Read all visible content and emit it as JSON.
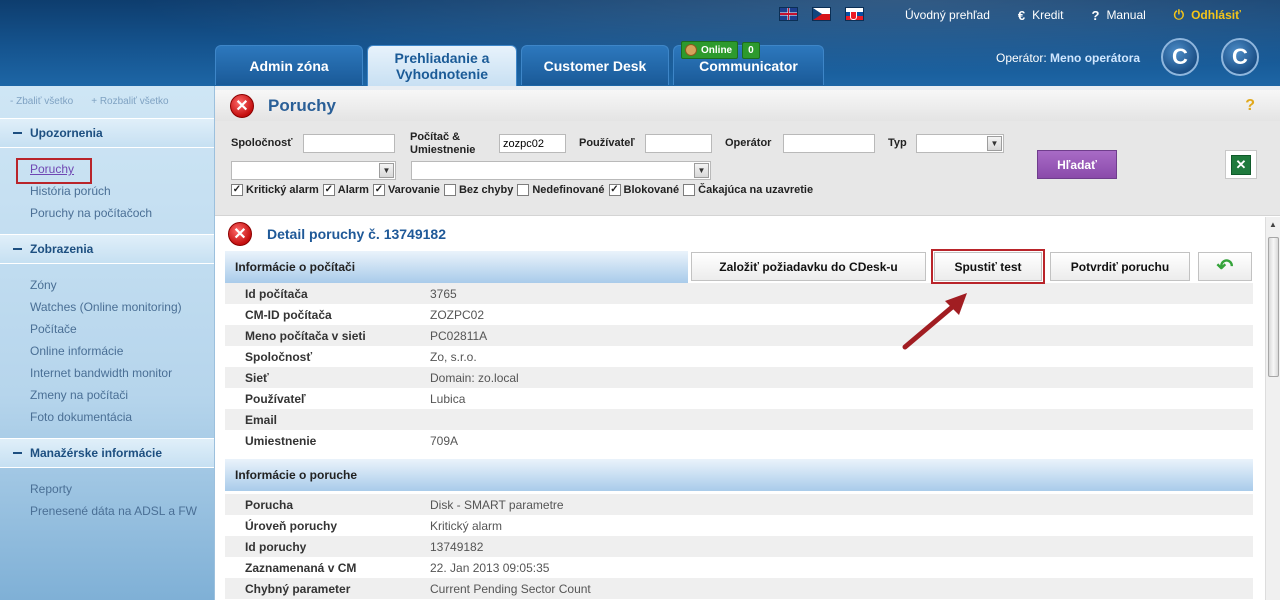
{
  "header": {
    "flags": [
      "uk-flag",
      "cz-flag",
      "sk-flag"
    ],
    "links": {
      "home": "Úvodný prehľad",
      "credit": "Kredit",
      "manual": "Manual",
      "logout": "Odhlásiť"
    },
    "tabs": [
      "Admin zóna",
      "Prehliadanie a Vyhodnotenie",
      "Customer Desk",
      "Communicator"
    ],
    "online": {
      "label": "Online",
      "count": "0"
    },
    "operator": {
      "label": "Operátor:",
      "name": "Meno operátora"
    }
  },
  "sidebar": {
    "collapse_all": "- Zbaliť všetko",
    "expand_all": "+ Rozbaliť všetko",
    "sections": [
      {
        "title": "Upozornenia",
        "items": [
          "Poruchy",
          "História porúch",
          "Poruchy na počítačoch"
        ]
      },
      {
        "title": "Zobrazenia",
        "items": [
          "Zóny",
          "Watches (Online monitoring)",
          "Počítače",
          "Online informácie",
          "Internet bandwidth monitor",
          "Zmeny na počítači",
          "Foto dokumentácia"
        ]
      },
      {
        "title": "Manažérske informácie",
        "items": [
          "Reporty",
          "Prenesené dáta na ADSL a FW"
        ]
      }
    ]
  },
  "page": {
    "title": "Poruchy",
    "help": "?"
  },
  "filters": {
    "company_label": "Spoločnosť",
    "computer_label": "Počítač &",
    "location_label": "Umiestnenie",
    "computer_value": "zozpc02",
    "user_label": "Používateľ",
    "operator_label": "Operátor",
    "type_label": "Typ",
    "checkboxes": [
      {
        "label": "Kritický alarm",
        "checked": true
      },
      {
        "label": "Alarm",
        "checked": true
      },
      {
        "label": "Varovanie",
        "checked": true
      },
      {
        "label": "Bez chyby",
        "checked": false
      },
      {
        "label": "Nedefinované",
        "checked": false
      },
      {
        "label": "Blokované",
        "checked": true
      },
      {
        "label": "Čakajúca na uzavretie",
        "checked": false
      }
    ],
    "search_button": "Hľadať"
  },
  "detail": {
    "title": "Detail poruchy č. 13749182",
    "actions": {
      "create_request": "Založiť požiadavku do CDesk-u",
      "run_test": "Spustiť test",
      "confirm": "Potvrdiť poruchu"
    },
    "computer_section": "Informácie o počítači",
    "computer_rows": [
      {
        "k": "Id počítača",
        "v": "3765"
      },
      {
        "k": "CM-ID počítača",
        "v": "ZOZPC02"
      },
      {
        "k": "Meno počítača v sieti",
        "v": "PC02811A"
      },
      {
        "k": "Spoločnosť",
        "v": "Zo, s.r.o."
      },
      {
        "k": "Sieť",
        "v": "Domain: zo.local"
      },
      {
        "k": "Používateľ",
        "v": "Lubica"
      },
      {
        "k": "Email",
        "v": ""
      },
      {
        "k": "Umiestnenie",
        "v": "709A"
      }
    ],
    "fault_section": "Informácie o poruche",
    "fault_rows": [
      {
        "k": "Porucha",
        "v": "Disk - SMART parametre"
      },
      {
        "k": "Úroveň poruchy",
        "v": "Kritický alarm"
      },
      {
        "k": "Id poruchy",
        "v": "13749182"
      },
      {
        "k": "Zaznamenaná v CM",
        "v": "22. Jan 2013 09:05:35"
      },
      {
        "k": "Chybný parameter",
        "v": "Current Pending Sector Count"
      }
    ]
  }
}
